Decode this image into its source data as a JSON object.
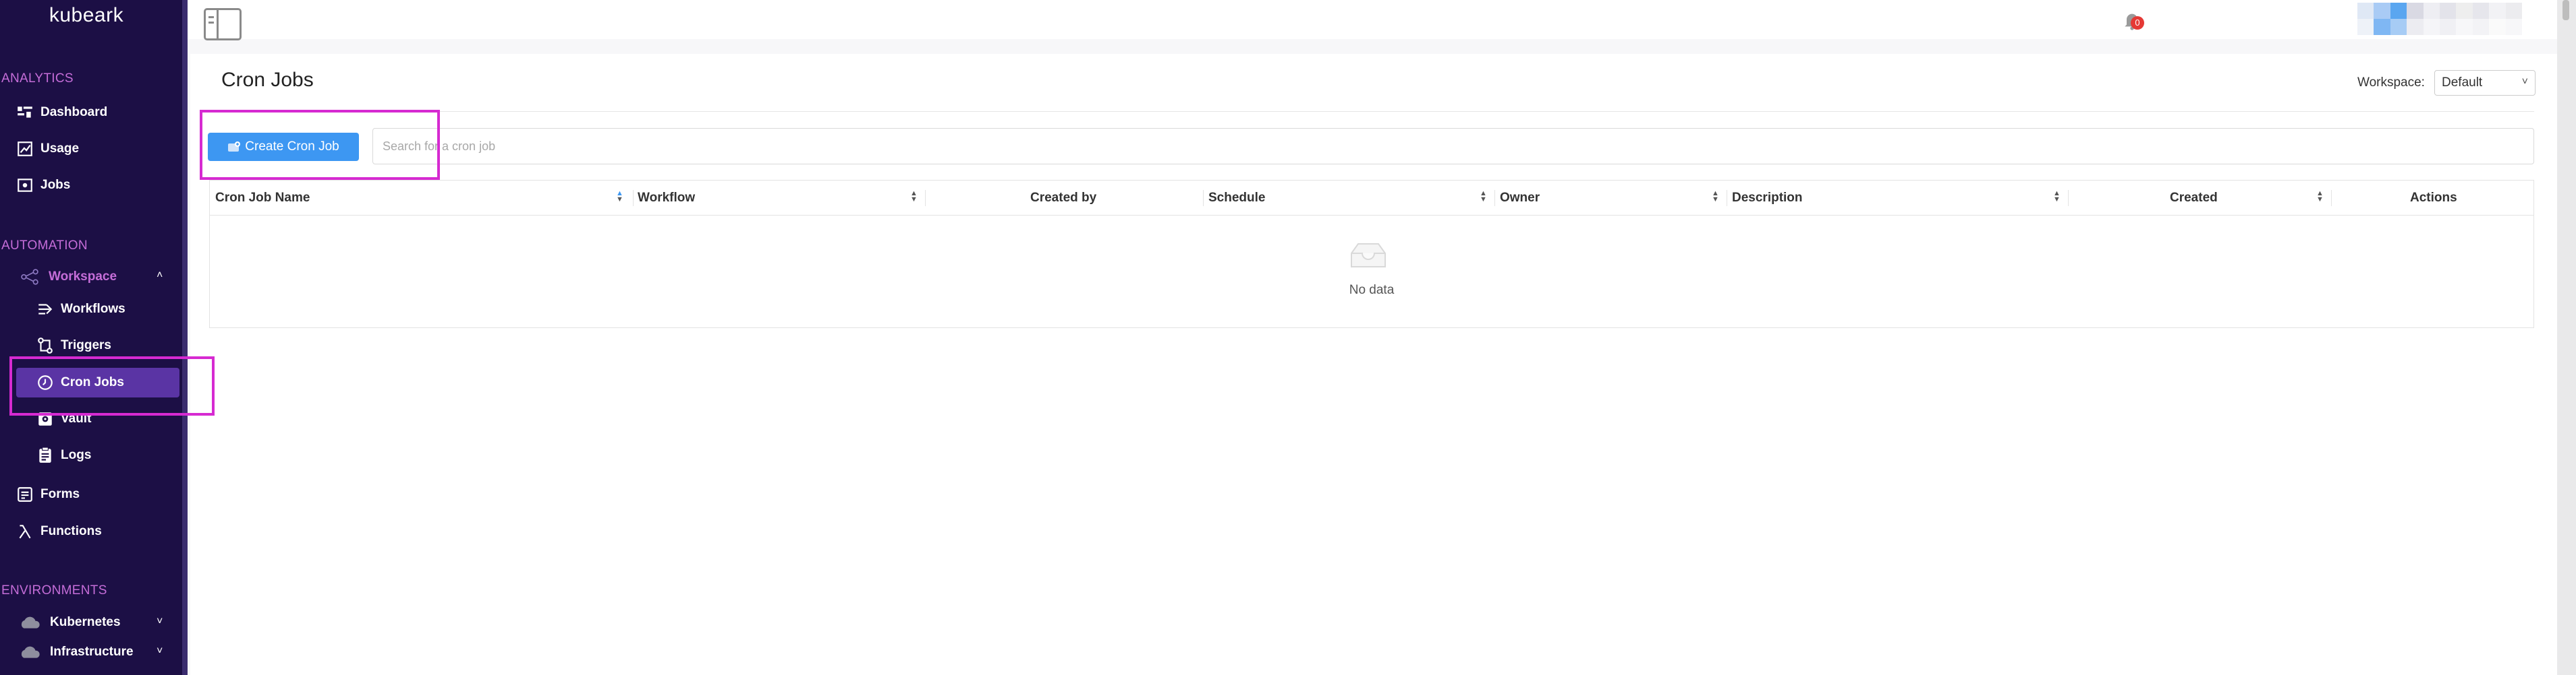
{
  "app": {
    "logo": "kubeark"
  },
  "sidebar": {
    "analytics_title": "ANALYTICS",
    "analytics": [
      {
        "label": "Dashboard",
        "icon": "dashboard-icon"
      },
      {
        "label": "Usage",
        "icon": "usage-icon"
      },
      {
        "label": "Jobs",
        "icon": "jobs-icon"
      }
    ],
    "automation_title": "AUTOMATION",
    "workspace_label": "Workspace",
    "workspace_items": [
      {
        "label": "Workflows",
        "icon": "workflows-icon"
      },
      {
        "label": "Triggers",
        "icon": "triggers-icon"
      },
      {
        "label": "Cron Jobs",
        "icon": "clock-icon",
        "active": true
      },
      {
        "label": "Vault",
        "icon": "vault-icon"
      },
      {
        "label": "Logs",
        "icon": "logs-icon"
      }
    ],
    "automation_extra": [
      {
        "label": "Forms",
        "icon": "forms-icon"
      },
      {
        "label": "Functions",
        "icon": "lambda-icon"
      }
    ],
    "environments_title": "ENVIRONMENTS",
    "environments": [
      {
        "label": "Kubernetes",
        "icon": "cloud-icon"
      },
      {
        "label": "Infrastructure",
        "icon": "cloud-icon"
      }
    ]
  },
  "topbar": {
    "notification_count": "0"
  },
  "page": {
    "title": "Cron Jobs",
    "workspace_label": "Workspace:",
    "workspace_value": "Default",
    "create_button": "Create Cron Job",
    "search_placeholder": "Search for a cron job"
  },
  "table": {
    "columns": [
      "Cron Job Name",
      "Workflow",
      "Created by",
      "Schedule",
      "Owner",
      "Description",
      "Created",
      "Actions"
    ],
    "empty_text": "No data"
  },
  "colors": {
    "sidebar_bg": "#1c0f45",
    "sidebar_active": "#5a34a4",
    "section_title": "#c56dd8",
    "primary_button": "#3d97f2",
    "highlight": "#d62ad1"
  }
}
